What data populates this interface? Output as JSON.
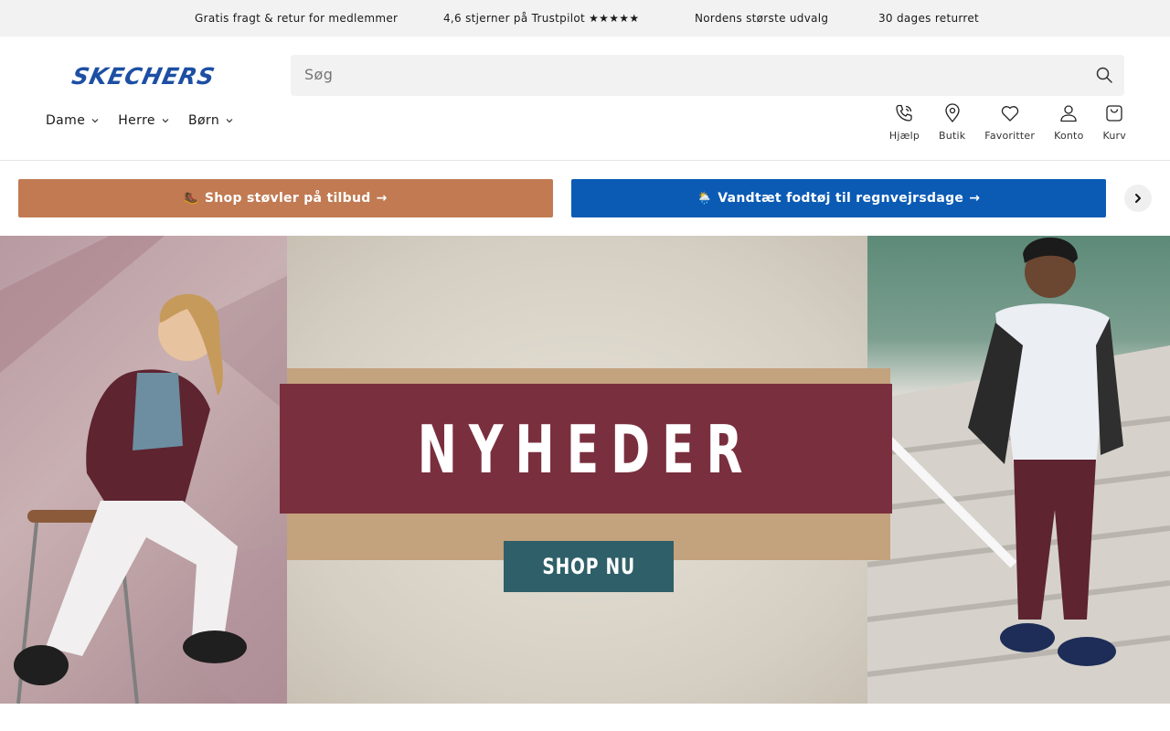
{
  "announcements": [
    "Gratis fragt & retur for medlemmer",
    "4,6 stjerner på Trustpilot ★★★★★",
    "Nordens største udvalg",
    "30 dages returret"
  ],
  "brand": {
    "logo_text": "SKECHERS",
    "color": "#1d4fa3"
  },
  "search": {
    "placeholder": "Søg"
  },
  "nav": [
    "Dame",
    "Herre",
    "Børn"
  ],
  "utilities": [
    {
      "label": "Hjælp",
      "icon": "phone-icon"
    },
    {
      "label": "Butik",
      "icon": "location-pin-icon"
    },
    {
      "label": "Favoritter",
      "icon": "heart-icon"
    },
    {
      "label": "Konto",
      "icon": "user-icon"
    },
    {
      "label": "Kurv",
      "icon": "bag-icon"
    }
  ],
  "promos": [
    {
      "emoji": "🥾",
      "label": "Shop støvler på tilbud",
      "color": "#c17a52"
    },
    {
      "emoji": "🌦️",
      "label": "Vandtæt fodtøj til regnvejrsdage",
      "color": "#0b5bb5"
    }
  ],
  "hero": {
    "title": "NYHEDER",
    "cta": "SHOP NU"
  }
}
